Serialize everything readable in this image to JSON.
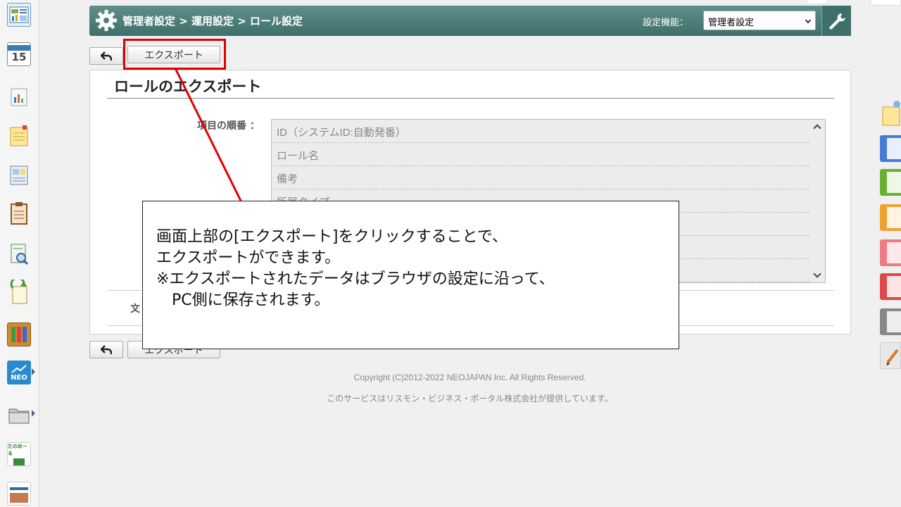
{
  "header": {
    "breadcrumb": "管理者設定 > 運用設定 > ロール設定",
    "function_label": "設定機能：",
    "function_select_value": "管理者設定"
  },
  "toolbar": {
    "back_symbol": "↰",
    "export_label": "エクスポート"
  },
  "panel": {
    "title": "ロールのエクスポート",
    "order_label": "項目の順番 ：",
    "items": [
      "ID（システムID:自動発番）",
      "ロール名",
      "備考",
      "所属タイプ",
      "",
      "",
      ""
    ],
    "charset_label_partial": "文"
  },
  "bottom_toolbar": {
    "back_symbol": "↰",
    "export_label": "エクスポート"
  },
  "footer": {
    "copyright": "Copyright (C)2012-2022 NEOJAPAN Inc. All Rights Reserved.",
    "provider": "このサービスはリスモン・ビジネス・ポータル株式会社が提供しています。"
  },
  "callout": {
    "lines": [
      "画面上部の[エクスポート]をクリックすることで、",
      "エクスポートができます。",
      "※エクスポートされたデータはブラウザの設定に沿って、",
      "　PC側に保存されます。"
    ]
  },
  "left_apps": [
    {
      "name": "portal-icon"
    },
    {
      "name": "calendar-icon",
      "label": "15"
    },
    {
      "name": "chart-icon"
    },
    {
      "name": "memo-icon"
    },
    {
      "name": "bulletin-icon"
    },
    {
      "name": "clipboard-icon"
    },
    {
      "name": "search-doc-icon"
    },
    {
      "name": "refresh-doc-icon"
    },
    {
      "name": "cabinet-icon"
    },
    {
      "name": "neo-icon",
      "label": "NEO"
    },
    {
      "name": "folder-icon"
    },
    {
      "name": "tanomeru-icon",
      "label": "たのめーる"
    },
    {
      "name": "banner-icon"
    }
  ],
  "colors": {
    "header_bg": "#4f7f7a",
    "accent_red": "#e00000"
  }
}
